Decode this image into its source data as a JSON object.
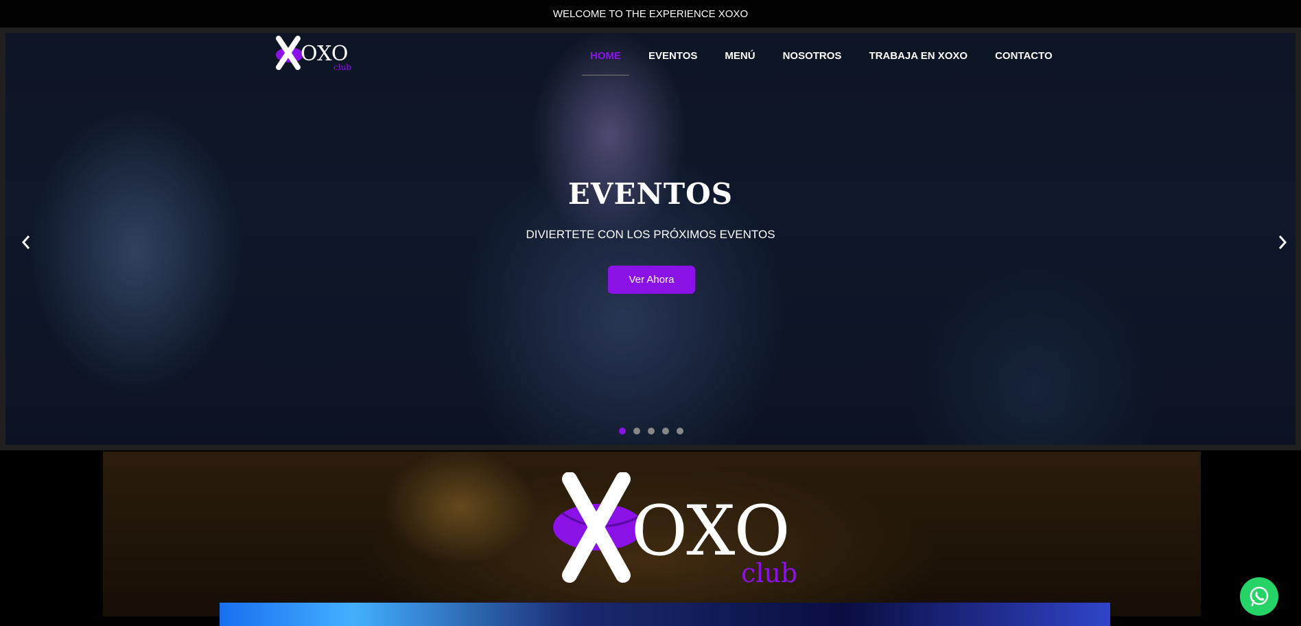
{
  "topbar": {
    "text": "WELCOME TO THE EXPERIENCE XOXO"
  },
  "logo": {
    "main": "OXO",
    "sub": "club"
  },
  "nav": {
    "items": [
      {
        "label": "HOME",
        "active": true
      },
      {
        "label": "EVENTOS"
      },
      {
        "label": "MENÚ"
      },
      {
        "label": "NOSOTROS"
      },
      {
        "label": "TRABAJA EN XOXO"
      },
      {
        "label": "CONTACTO"
      }
    ]
  },
  "hero": {
    "title": "EVENTOS",
    "subtitle": "DIVIERTETE CON LOS PRÓXIMOS EVENTOS",
    "button": "Ver Ahora",
    "slides": 5,
    "active_slide": 1
  },
  "colors": {
    "accent": "#8a12e6",
    "whatsapp": "#25d366"
  },
  "icons": {
    "prev": "chevron-left-icon",
    "next": "chevron-right-icon",
    "chat": "whatsapp-icon"
  }
}
